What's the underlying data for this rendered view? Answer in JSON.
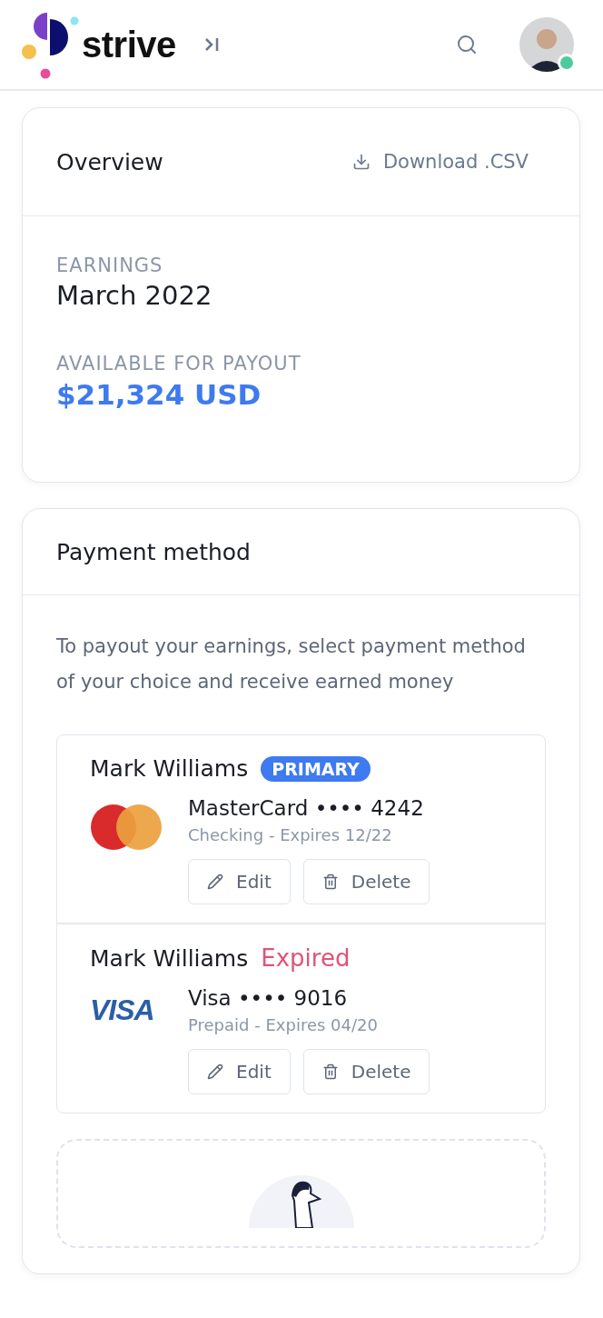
{
  "header": {
    "logo_text": "strive",
    "user_online": true
  },
  "overview": {
    "title": "Overview",
    "download": "Download .CSV",
    "earnings_label": "EARNINGS",
    "earnings_period": "March 2022",
    "payout_label": "AVAILABLE FOR PAYOUT",
    "payout_amount": "$21,324 USD"
  },
  "payment": {
    "title": "Payment method",
    "description": "To payout your earnings, select payment method of your choice and receive earned money",
    "methods": [
      {
        "holder": "Mark Williams",
        "status": {
          "kind": "primary",
          "label": "PRIMARY"
        },
        "brand": {
          "kind": "mastercard"
        },
        "card": "MasterCard •••• 4242",
        "detail": "Checking - Expires 12/22",
        "actions": [
          "Edit",
          "Delete"
        ]
      },
      {
        "holder": "Mark Williams",
        "status": {
          "kind": "expired",
          "label": "Expired"
        },
        "brand": {
          "kind": "visa",
          "logo_text": "VISA"
        },
        "card": "Visa •••• 9016",
        "detail": "Prepaid - Expires 04/20",
        "actions": [
          "Edit",
          "Delete"
        ]
      }
    ]
  }
}
